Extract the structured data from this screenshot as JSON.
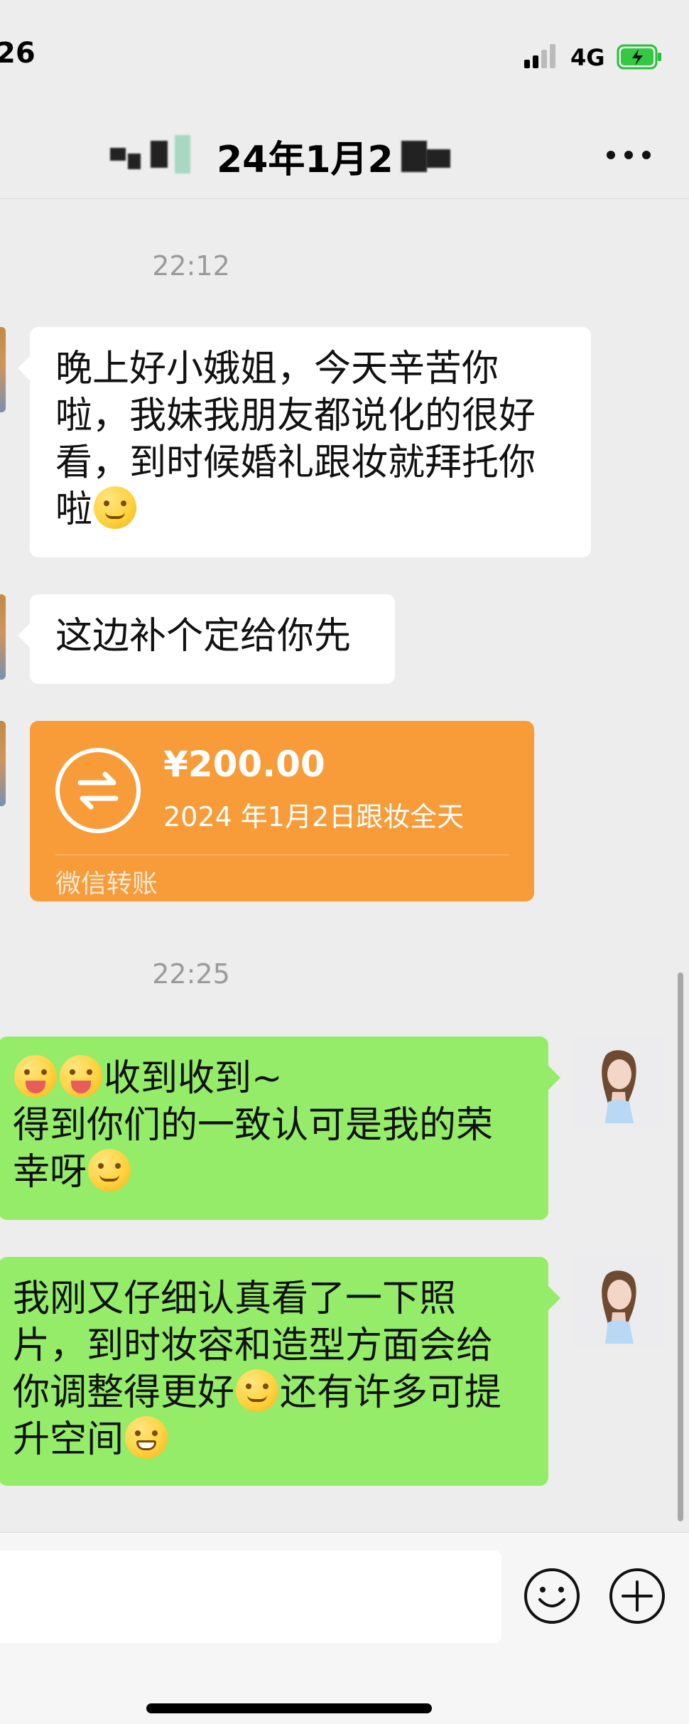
{
  "status_bar": {
    "time": "26",
    "network": "4G",
    "icons": [
      "signal-icon",
      "battery-charging-icon"
    ]
  },
  "nav": {
    "title": "24年1月2",
    "more_icon": "more-dots-icon"
  },
  "chat": {
    "timestamps": [
      "22:12",
      "22:25"
    ],
    "messages": [
      {
        "side": "left",
        "text": "晚上好小娥姐，今天辛苦你啦，我妹我朋友都说化的很好看，到时候婚礼跟妆就拜托你啦",
        "emoji": "smirk-face-emoji"
      },
      {
        "side": "left",
        "text": "这边补个定给你先"
      },
      {
        "side": "left",
        "type": "transfer",
        "amount": "¥200.00",
        "note": "2024 年1月2日跟妆全天",
        "footer": "微信转账",
        "icon": "transfer-arrows-icon"
      },
      {
        "side": "right",
        "line1": "收到收到~",
        "line2": "得到你们的一致认可是我的荣幸呀",
        "emojis_prefix": [
          "tongue-face-emoji",
          "tongue-face-emoji"
        ],
        "emoji_suffix": "smile-face-emoji"
      },
      {
        "side": "right",
        "part1": "我刚又仔细认真看了一下照片，到时妆容和造型方面会给你调整得更好",
        "part2": "还有许多可提升空间",
        "emoji_mid": "thinking-face-emoji",
        "emoji_end": "grin-face-emoji"
      }
    ]
  },
  "input_bar": {
    "placeholder": "",
    "emoji_button_icon": "emoji-icon",
    "plus_button_icon": "plus-icon"
  },
  "colors": {
    "background": "#ededed",
    "bubble_left": "#ffffff",
    "bubble_right": "#95ec69",
    "transfer": "#f79c39"
  }
}
